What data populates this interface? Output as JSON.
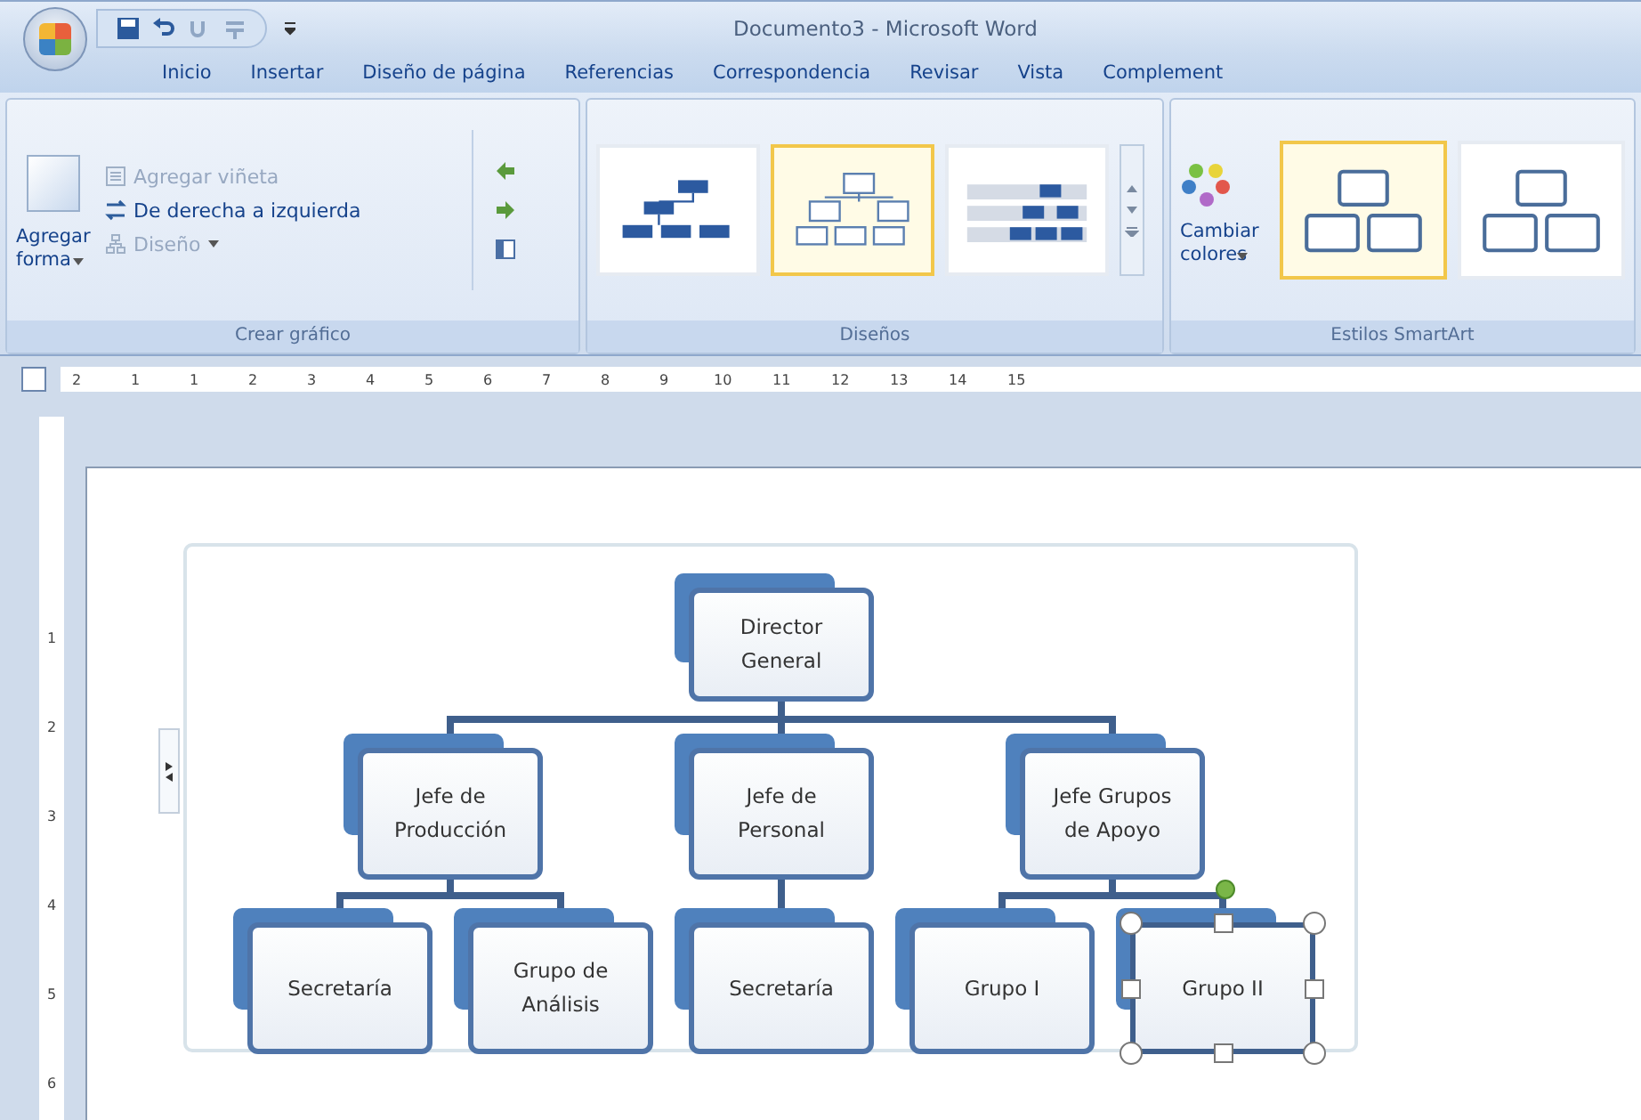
{
  "window": {
    "title": "Documento3 - Microsoft Word"
  },
  "tabs": [
    {
      "label": "Inicio",
      "selected": false
    },
    {
      "label": "Insertar",
      "selected": false
    },
    {
      "label": "Diseño de página",
      "selected": false
    },
    {
      "label": "Referencias",
      "selected": false
    },
    {
      "label": "Correspondencia",
      "selected": false
    },
    {
      "label": "Revisar",
      "selected": false
    },
    {
      "label": "Vista",
      "selected": false
    },
    {
      "label": "Complement",
      "selected": false
    }
  ],
  "ribbon": {
    "create": {
      "label": "Crear gráfico",
      "add_shape": "Agregar forma",
      "commands": [
        {
          "label": "Agregar viñeta",
          "disabled": true
        },
        {
          "label": "De derecha a izquierda",
          "disabled": false
        },
        {
          "label": "Diseño",
          "disabled": true
        }
      ]
    },
    "layouts": {
      "label": "Diseños",
      "items": [
        {
          "selected": false
        },
        {
          "selected": true
        },
        {
          "selected": false
        }
      ]
    },
    "styles": {
      "label": "Estilos SmartArt",
      "change_colors": "Cambiar colores",
      "items": [
        {
          "selected": true
        },
        {
          "selected": false
        }
      ]
    }
  },
  "ruler": {
    "horizontal": [
      "2",
      "1",
      "1",
      "2",
      "3",
      "4",
      "5",
      "6",
      "7",
      "8",
      "9",
      "10",
      "11",
      "12",
      "13",
      "14",
      "15"
    ],
    "vertical": [
      "1",
      "2",
      "3",
      "4",
      "5",
      "6"
    ]
  },
  "org_chart": {
    "label": "Director General",
    "selected": false,
    "children": [
      {
        "label": "Jefe de Producción",
        "selected": false,
        "children": [
          {
            "label": "Secretaría",
            "selected": false
          },
          {
            "label": "Grupo de Análisis",
            "selected": false
          }
        ]
      },
      {
        "label": "Jefe de Personal",
        "selected": false,
        "children": [
          {
            "label": "Secretaría",
            "selected": false
          }
        ]
      },
      {
        "label": "Jefe Grupos de Apoyo",
        "selected": false,
        "children": [
          {
            "label": "Grupo I",
            "selected": false
          },
          {
            "label": "Grupo II",
            "selected": true
          }
        ]
      }
    ]
  }
}
